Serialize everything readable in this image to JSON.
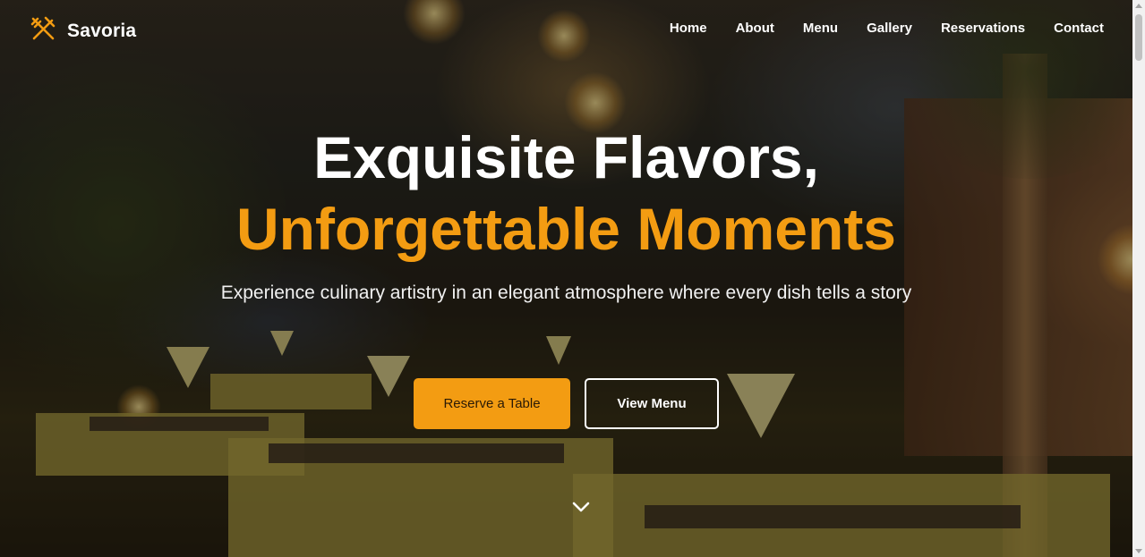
{
  "brand": {
    "name": "Savoria",
    "icon": "utensils-icon",
    "accent_color": "#f39c12"
  },
  "nav": {
    "items": [
      {
        "label": "Home"
      },
      {
        "label": "About"
      },
      {
        "label": "Menu"
      },
      {
        "label": "Gallery"
      },
      {
        "label": "Reservations"
      },
      {
        "label": "Contact"
      }
    ]
  },
  "hero": {
    "title_line1": "Exquisite Flavors,",
    "title_line2": "Unforgettable Moments",
    "subtitle": "Experience culinary artistry in an elegant atmosphere where every dish tells a story",
    "primary_button": "Reserve a Table",
    "secondary_button": "View Menu",
    "scroll_icon": "chevron-down-icon"
  }
}
